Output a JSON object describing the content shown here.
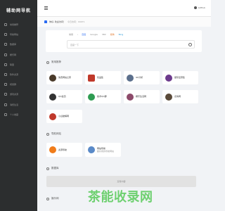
{
  "sidebar": {
    "logo_text": "辅助网导航",
    "items": [
      {
        "label": "常用推荐"
      },
      {
        "label": "导航网站"
      },
      {
        "label": "数据库"
      },
      {
        "label": "娱乐网"
      },
      {
        "label": "联盟"
      },
      {
        "label": "软件资源"
      },
      {
        "label": "视觉群"
      },
      {
        "label": "游戏资源"
      },
      {
        "label": "消费生活"
      },
      {
        "label": "个人收藏"
      }
    ]
  },
  "topbar": {
    "github_label": "GitHub"
  },
  "notice": {
    "text": "你好, 欢迎访问！",
    "muted": "今日访问：00071"
  },
  "search": {
    "tabs": [
      "常用",
      "百度",
      "Google",
      "360",
      "搜狗",
      "Bing"
    ],
    "placeholder": "百度一下"
  },
  "sections": {
    "common": {
      "title": "常用推荐",
      "cards": [
        {
          "name": "免费网站之家",
          "color": "#4a3a2a"
        },
        {
          "name": "优品集",
          "color": "#c0392b"
        },
        {
          "name": "GK分析",
          "color": "#5b6f8c"
        },
        {
          "name": "星际爱意集",
          "color": "#6c3a8c"
        },
        {
          "name": "QQ会员",
          "color": "#333333"
        },
        {
          "name": "技术QQ群",
          "color": "#2e9c52"
        },
        {
          "name": "娱乐生活网",
          "color": "#8c4a6a"
        },
        {
          "name": "表情网",
          "color": "#5a4a3a"
        },
        {
          "name": "小白破解网",
          "color": "#c0392b"
        }
      ]
    },
    "nav": {
      "title": "导航网站",
      "cards": [
        {
          "name": "资源导航",
          "sub": "",
          "color": "#f07c1a"
        },
        {
          "name": "网站导航",
          "sub": "超好用的导航网站",
          "color": "#5a8ac8"
        }
      ]
    },
    "database": {
      "title": "数据库",
      "empty_text": "没有内容"
    },
    "entertain": {
      "title": "娱乐网"
    }
  },
  "watermark": {
    "text": "茶能收录网"
  }
}
